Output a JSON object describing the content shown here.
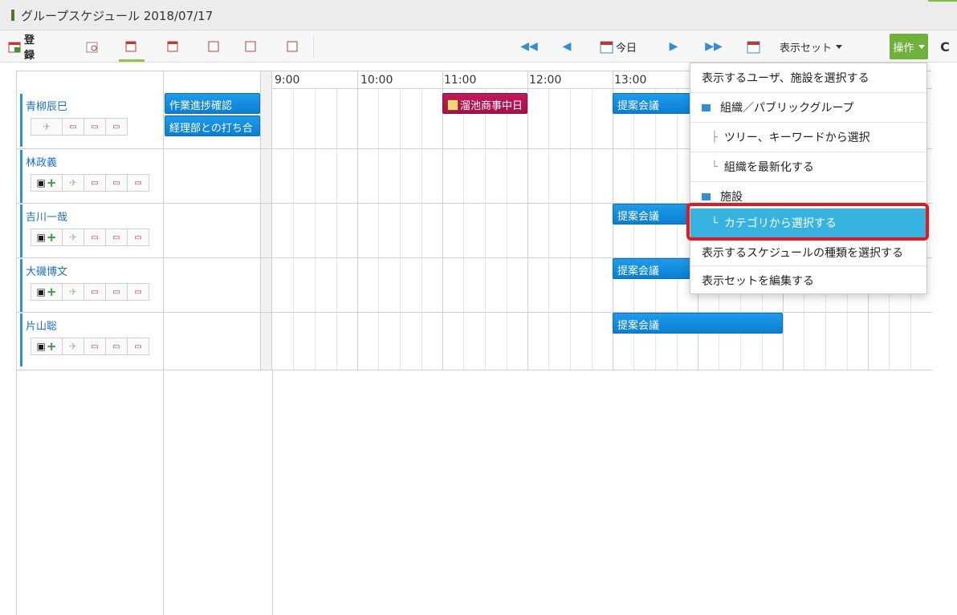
{
  "window": {
    "title": "グループスケジュール 2018/07/17"
  },
  "toolbar": {
    "register_label": "登録",
    "today_label": "今日",
    "display_set_label": "表示セット",
    "operations_label": "操作",
    "icon_day": "1",
    "icon_week": "7",
    "icon_month": "31",
    "refresh_glyph": "C"
  },
  "timeline": {
    "hours": [
      "9:00",
      "10:00",
      "11:00",
      "12:00",
      "13:00"
    ]
  },
  "users": [
    {
      "name": "青柳辰巳"
    },
    {
      "name": "林政義"
    },
    {
      "name": "吉川一哉"
    },
    {
      "name": "大磯博文"
    },
    {
      "name": "片山聡"
    }
  ],
  "events": {
    "allday_1": "作業進捗確認",
    "allday_2": "経理部との打ち合",
    "meeting_red": "溜池商事中日",
    "proposal": "提案会議"
  },
  "menu": {
    "items": [
      "表示するユーザ、施設を選択する",
      "組織／パブリックグループ",
      "ツリー、キーワードから選択",
      "組織を最新化する",
      "施設",
      "カテゴリから選択する",
      "表示するスケジュールの種類を選択する",
      "表示セットを編集する"
    ]
  },
  "colors": {
    "accent_green": "#6fb13a",
    "event_blue": "#0b7fd1",
    "event_red": "#a8104a",
    "menu_active": "#36b3e0",
    "highlight_red": "#e8161d"
  }
}
